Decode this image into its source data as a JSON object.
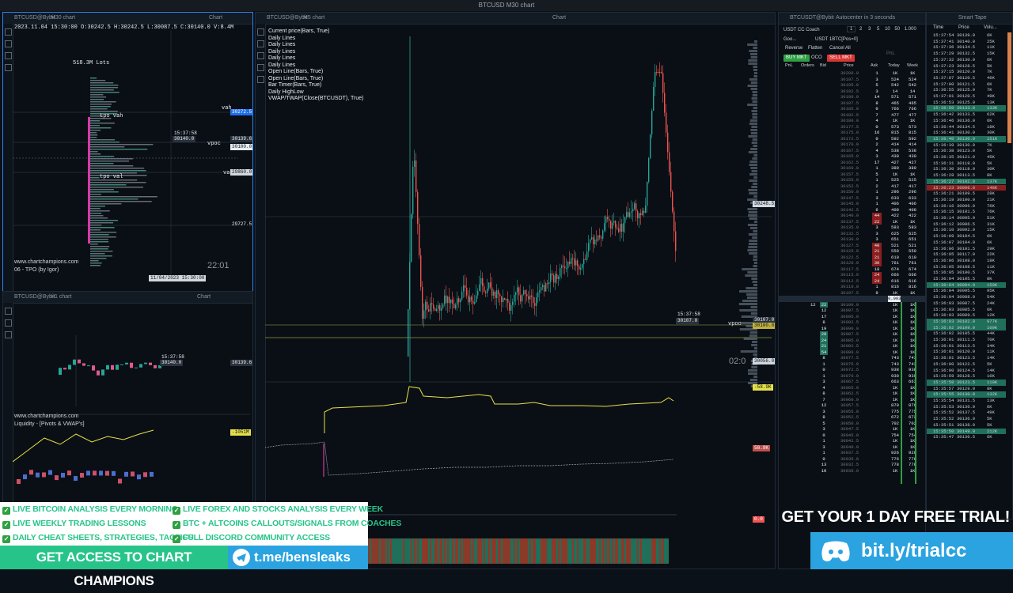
{
  "window": {
    "title": "BTCUSD M30 chart"
  },
  "tpo_panel": {
    "symbol": "BTCUSD@Bybit",
    "timeframe": "M30 chart",
    "mode": "Chart",
    "ohlc": "2023.11.04 15:30:00 O:30242.5 H:30242.5 L:30087.5 C:30140.0 V:8.4M",
    "lots_label": "518.3M Lots",
    "tpo_vah": "tpo vah",
    "tpo_val": "tpo val",
    "vah": "vah",
    "vpoc": "vpoc",
    "val": "val",
    "time_tag": "15:37:58",
    "price_tags": [
      "30272.5",
      "30139.6",
      "30100.0",
      "29860.0",
      "29727.5"
    ],
    "current_price": "30140.0",
    "watermark": "www.chartchampions.com",
    "indicator": "06 - TPO (by Igor)",
    "date_tag": "11/04/2023 15:30:00",
    "clock": "22:01"
  },
  "h1_panel": {
    "symbol": "BTCUSD@Bybit",
    "timeframe": "H1 chart",
    "mode": "Chart",
    "time_tag": "15:37:58",
    "current_price": "30140.0",
    "price_tag": "30139.6",
    "watermark": "www.chartchampions.com",
    "indicator": "Liquidity - [Pivots & VWAP's]",
    "liq_tag": "-1051M"
  },
  "main_chart": {
    "symbol": "BTCUSD@Bybit",
    "timeframe": "M5 chart",
    "mode": "Chart",
    "legend": [
      "Current price(Bars, True)",
      "Daily Lines",
      "Daily Lines",
      "Daily Lines",
      "Daily Lines",
      "Daily Lines",
      "Open Line(Bars, True)",
      "Open Line(Bars, True)",
      "Bar Timer(Bars, True)",
      "Daily HighLow",
      "VWAP/TWAP(Close(BTCUSDT), True)"
    ],
    "time_tag": "15:37:58",
    "current_price": "30107.0",
    "price_tags": [
      "30248.5",
      "30107.0",
      "30100.0",
      "30056.0"
    ],
    "vpoc": "vpoc",
    "timer": "02:0",
    "indicator_tags": [
      "-58.9K",
      "58.9K",
      "0.0"
    ]
  },
  "dom": {
    "title": "BTCUSDT@Bybit",
    "subtitle": "Autocenter in 3 seconds",
    "account": "USDT CC Coach",
    "qty_buttons": [
      "1",
      "2",
      "3",
      "5",
      "10",
      "50"
    ],
    "qty_value": "1.000",
    "good": "Goo...",
    "position": "USDT 1BTC[Pos=0]",
    "reverse": "Reverse",
    "flatten": "Flatten",
    "cancel_all": "Cancel All",
    "pnl_label": "PnL",
    "buy_mkt": "BUY MKT",
    "oco": "OCO",
    "sell_mkt": "SELL MKT",
    "columns": [
      "PnL",
      "Orders",
      "Bid",
      "Price",
      "Ask",
      "Today",
      "Week"
    ],
    "highlight_value": "0.903",
    "rows": [
      [
        "30200.0",
        "1",
        "1K",
        "1K"
      ],
      [
        "30197.5",
        "3",
        "524",
        "524"
      ],
      [
        "30195.0",
        "5",
        "542",
        "542"
      ],
      [
        "30192.5",
        "3",
        "14",
        "14"
      ],
      [
        "30190.0",
        "14",
        "571",
        "571"
      ],
      [
        "30187.5",
        "8",
        "465",
        "465"
      ],
      [
        "30185.0",
        "0",
        "766",
        "766"
      ],
      [
        "30182.5",
        "7",
        "477",
        "477"
      ],
      [
        "30180.0",
        "4",
        "1K",
        "1K"
      ],
      [
        "30177.5",
        "0",
        "573",
        "573"
      ],
      [
        "30175.0",
        "16",
        "815",
        "815"
      ],
      [
        "30172.5",
        "0",
        "592",
        "592"
      ],
      [
        "30170.0",
        "2",
        "414",
        "414"
      ],
      [
        "30167.5",
        "4",
        "538",
        "538"
      ],
      [
        "30165.0",
        "3",
        "430",
        "430"
      ],
      [
        "30162.5",
        "17",
        "427",
        "427"
      ],
      [
        "30160.0",
        "1",
        "389",
        "389"
      ],
      [
        "30157.5",
        "5",
        "1K",
        "1K"
      ],
      [
        "30155.0",
        "1",
        "525",
        "525"
      ],
      [
        "30152.5",
        "2",
        "417",
        "417"
      ],
      [
        "30150.0",
        "1",
        "296",
        "296"
      ],
      [
        "30147.5",
        "3",
        "633",
        "633"
      ],
      [
        "30145.0",
        "1",
        "406",
        "406"
      ],
      [
        "30142.5",
        "6",
        "408",
        "408"
      ],
      [
        "30140.0",
        "44",
        "422",
        "422"
      ],
      [
        "30137.5",
        "22",
        "1K",
        "1K"
      ],
      [
        "30135.0",
        "3",
        "583",
        "583"
      ],
      [
        "30132.5",
        "3",
        "625",
        "625"
      ],
      [
        "30130.0",
        "3",
        "651",
        "651"
      ],
      [
        "30127.5",
        "40",
        "521",
        "521"
      ],
      [
        "30125.0",
        "21",
        "559",
        "559"
      ],
      [
        "30122.5",
        "21",
        "610",
        "610"
      ],
      [
        "30120.0",
        "30",
        "761",
        "761"
      ],
      [
        "30117.5",
        "18",
        "674",
        "674"
      ],
      [
        "30115.0",
        "24",
        "666",
        "666"
      ],
      [
        "30112.5",
        "24",
        "616",
        "616"
      ],
      [
        "30110.0",
        "1",
        "816",
        "816"
      ],
      [
        "30107.5",
        "9",
        "1K",
        "1K"
      ]
    ],
    "bid_rows": [
      [
        "30100.0",
        "22",
        "12",
        "1K"
      ],
      [
        "30097.5",
        "12",
        "",
        "1K"
      ],
      [
        "30095.0",
        "17",
        "",
        "1K"
      ],
      [
        "30092.5",
        "8",
        "",
        "1K"
      ],
      [
        "30090.0",
        "19",
        "",
        "1K"
      ],
      [
        "30087.5",
        "20",
        "",
        "1K"
      ],
      [
        "30085.0",
        "24",
        "",
        "1K"
      ],
      [
        "30082.5",
        "21",
        "",
        "1K"
      ],
      [
        "30080.0",
        "54",
        "",
        "1K"
      ],
      [
        "30077.5",
        "8",
        "",
        "743"
      ],
      [
        "30075.0",
        "1",
        "",
        "743"
      ],
      [
        "30072.5",
        "0",
        "",
        "938"
      ],
      [
        "30070.0",
        "1",
        "",
        "930"
      ],
      [
        "30067.5",
        "3",
        "",
        "663"
      ],
      [
        "30065.0",
        "4",
        "",
        "1K"
      ],
      [
        "30062.5",
        "8",
        "",
        "1K"
      ],
      [
        "30060.0",
        "7",
        "",
        "1K"
      ],
      [
        "30057.5",
        "12",
        "",
        "879"
      ],
      [
        "30055.0",
        "3",
        "",
        "775"
      ],
      [
        "30052.5",
        "8",
        "",
        "672"
      ],
      [
        "30050.0",
        "5",
        "",
        "702"
      ],
      [
        "30047.5",
        "3",
        "",
        "1K"
      ],
      [
        "30045.0",
        "0",
        "",
        "754"
      ],
      [
        "30042.5",
        "1",
        "",
        "1K"
      ],
      [
        "30040.0",
        "3",
        "",
        "1K"
      ],
      [
        "30037.5",
        "1",
        "",
        "926"
      ],
      [
        "30035.0",
        "0",
        "",
        "776"
      ],
      [
        "30032.5",
        "13",
        "",
        "778"
      ],
      [
        "30030.0",
        "10",
        "",
        "1K"
      ]
    ]
  },
  "tape": {
    "title": "Smart Tape",
    "columns": [
      "Time",
      "Price",
      "Volu..."
    ],
    "rows": [
      [
        "15:37:54",
        "30139.9",
        "6K"
      ],
      [
        "15:37:41",
        "30140.0",
        "25K"
      ],
      [
        "15:37:36",
        "30134.5",
        "11K"
      ],
      [
        "15:37:29",
        "30132.5",
        "15K"
      ],
      [
        "15:37:32",
        "30130.0",
        "6K"
      ],
      [
        "15:37:23",
        "30128.5",
        "5K"
      ],
      [
        "15:37:15",
        "30120.0",
        "7K"
      ],
      [
        "15:37:07",
        "30120.5",
        "46K"
      ],
      [
        "15:37:00",
        "30121.5",
        "6K"
      ],
      [
        "15:36:55",
        "30125.0",
        "7K"
      ],
      [
        "15:37:01",
        "30120.5",
        "49K"
      ],
      [
        "15:36:53",
        "30125.0",
        "13K"
      ],
      [
        "15:36:50",
        "30133.0",
        "133K"
      ],
      [
        "15:36:42",
        "30133.5",
        "62K"
      ],
      [
        "15:36:46",
        "30136.0",
        "6K"
      ],
      [
        "15:36:44",
        "30134.5",
        "18K"
      ],
      [
        "15:36:41",
        "30130.0",
        "30K"
      ],
      [
        "15:36:40",
        "30130.0",
        "151K"
      ],
      [
        "15:36:39",
        "30130.0",
        "7K"
      ],
      [
        "15:36:38",
        "30123.0",
        "5K"
      ],
      [
        "15:36:35",
        "30121.0",
        "45K"
      ],
      [
        "15:36:31",
        "30118.0",
        "5K"
      ],
      [
        "15:36:30",
        "30118.0",
        "30K"
      ],
      [
        "15:36:28",
        "30113.5",
        "8K"
      ],
      [
        "15:36:27",
        "30102.0",
        "137K"
      ],
      [
        "15:36:23",
        "30096.0",
        "148K"
      ],
      [
        "15:36:21",
        "30109.5",
        "28K"
      ],
      [
        "15:36:19",
        "30100.0",
        "21K"
      ],
      [
        "15:36:16",
        "30096.0",
        "76K"
      ],
      [
        "15:36:15",
        "30101.5",
        "76K"
      ],
      [
        "15:36:14",
        "30095.0",
        "51K"
      ],
      [
        "15:36:12",
        "30086.5",
        "31K"
      ],
      [
        "15:36:10",
        "30092.0",
        "15K"
      ],
      [
        "15:36:09",
        "30104.5",
        "6K"
      ],
      [
        "15:36:07",
        "30104.0",
        "6K"
      ],
      [
        "15:36:06",
        "30101.5",
        "29K"
      ],
      [
        "15:36:05",
        "30117.0",
        "22K"
      ],
      [
        "15:36:06",
        "30108.0",
        "18K"
      ],
      [
        "15:36:05",
        "30108.5",
        "11K"
      ],
      [
        "15:36:05",
        "30100.5",
        "37K"
      ],
      [
        "15:36:04",
        "30105.5",
        "8K"
      ],
      [
        "15:36:04",
        "30094.0",
        "150K"
      ],
      [
        "15:36:04",
        "30095.5",
        "95K"
      ],
      [
        "15:36:04",
        "30088.0",
        "54K"
      ],
      [
        "15:36:03",
        "30087.5",
        "24K"
      ],
      [
        "15:36:03",
        "30085.5",
        "6K"
      ],
      [
        "15:36:03",
        "30089.5",
        "12K"
      ],
      [
        "15:36:03",
        "30102.0",
        "977K"
      ],
      [
        "15:36:02",
        "30109.0",
        "109K"
      ],
      [
        "15:36:02",
        "30105.5",
        "44K"
      ],
      [
        "15:36:01",
        "30111.5",
        "70K"
      ],
      [
        "15:36:01",
        "30113.5",
        "34K"
      ],
      [
        "15:36:01",
        "30120.0",
        "11K"
      ],
      [
        "15:36:01",
        "30123.5",
        "14K"
      ],
      [
        "15:36:00",
        "30122.5",
        "5K"
      ],
      [
        "15:36:00",
        "30124.5",
        "14K"
      ],
      [
        "15:35:59",
        "30128.5",
        "16K"
      ],
      [
        "15:35:58",
        "30123.5",
        "110K"
      ],
      [
        "15:35:57",
        "30129.0",
        "8K"
      ],
      [
        "15:35:55",
        "30130.0",
        "132K"
      ],
      [
        "15:35:54",
        "30131.5",
        "13K"
      ],
      [
        "15:35:53",
        "30136.0",
        "6K"
      ],
      [
        "15:35:52",
        "30137.5",
        "49K"
      ],
      [
        "15:35:52",
        "30136.0",
        "5K"
      ],
      [
        "15:35:51",
        "30138.0",
        "5K"
      ],
      [
        "15:35:50",
        "30149.0",
        "212K"
      ],
      [
        "15:35:47",
        "30136.5",
        "6K"
      ]
    ]
  },
  "promo": {
    "bullets_left": [
      "LIVE BITCOIN ANALYSIS EVERY MORNING",
      "LIVE WEEKLY TRADING LESSONS",
      "DAILY CHEAT SHEETS, STRATEGIES, TACTICS"
    ],
    "bullets_right": [
      "LIVE FOREX AND STOCKS ANALYSIS EVERY WEEK",
      "BTC + ALTCOINS CALLOUTS/SIGNALS FROM COACHES",
      "FULL DISCORD COMMUNITY ACCESS"
    ],
    "cta": "GET ACCESS TO CHART CHAMPIONS",
    "telegram": "t.me/bensleaks",
    "trial": "GET YOUR 1 DAY FREE TRIAL!",
    "discord": "bit.ly/trialcc"
  },
  "colors": {
    "up": "#26a69a",
    "down": "#ef5350",
    "vwap": "#e6e04a",
    "accent": "#27c48a"
  }
}
